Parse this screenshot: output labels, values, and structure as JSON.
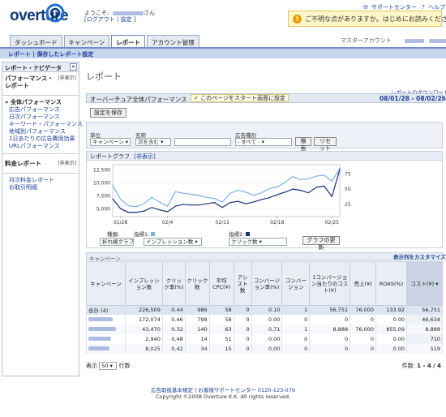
{
  "header": {
    "logo": "overture",
    "welcome_prefix": "ようこそ、",
    "welcome_suffix": "さん",
    "user_links": "[ログアウト | 設定 ]",
    "support_center": "サポートセンター",
    "help": "ヘルプ",
    "notice": "ご不明な点がありますか。はじめにお読みください。"
  },
  "tabs": [
    "ダッシュボード",
    "キャンペーン",
    "レポート",
    "アカウント管理"
  ],
  "active_tab": 2,
  "account_label": "マスターアカウント",
  "subnav": "レポート | 保存したレポート設定",
  "sidebar": {
    "title": "レポート・ナビゲータ",
    "collapse": "«",
    "perf_section": "パフォーマンス・レポート",
    "perf_visibility": "[非表示]",
    "perf_items": [
      "全体パフォーマンス",
      "広告パフォーマンス",
      "日次パフォーマンス",
      "キーワード・パフォーマンス",
      "地域別パフォーマンス",
      "1日あたりの広告費用効果",
      "URLパフォーマンス"
    ],
    "fee_section": "料金レポート",
    "fee_visibility": "[非表示]",
    "fee_items": [
      "月次料金レポート",
      "お取引明細"
    ]
  },
  "main": {
    "page_title": "レポート",
    "download_link": "レポートのダウンロード ▾",
    "report_title": "オーバーチュア全体パフォーマンス",
    "start_page_button": "このページをスタート画面に設定",
    "date_range": "08/01/28 - 08/02/26",
    "save_button": "設定を保存",
    "filters": {
      "unit_label": "単位",
      "unit_value": "キャンペーン",
      "name_label": "名称",
      "name_value": "次を含む",
      "adtype_label": "広告種別",
      "adtype_value": "- すべて -",
      "search_button": "検索",
      "reset_button": "リセット"
    },
    "graph": {
      "title": "レポートグラフ",
      "hide": "[非表示]",
      "type_label": "種類:",
      "type_value": "折れ線グラフ",
      "metric1_label": "指標1:",
      "metric1_value": "インプレッション数",
      "metric2_label": "指標2:",
      "metric2_value": "クリック数",
      "update_button": "グラフの更新"
    },
    "table": {
      "section_label": "キャンペーン",
      "customize_link": "表示列をカスタマイズ",
      "columns": [
        "キャンペーン",
        "インプレッション数",
        "クリック率(%)",
        "クリック数",
        "平均CPC(¥)",
        "アシスト数",
        "コンバージョン率(%)",
        "コンバージョン",
        "1コンバージョン当たりのコスト(¥)",
        "売上(¥)",
        "ROAS(%)",
        "コスト(¥) ▾"
      ],
      "total_row": [
        "合計 (4)",
        "226,509",
        "0.44",
        "986",
        "58",
        "0",
        "0.10",
        "1",
        "56,751",
        "76,000",
        "133.92",
        "56,751"
      ],
      "rows": [
        [
          "",
          "172,074",
          "0.46",
          "798",
          "58",
          "0",
          "0.00",
          "0",
          "0",
          "0",
          "0.00",
          "46,634"
        ],
        [
          "",
          "43,470",
          "0.32",
          "140",
          "63",
          "0",
          "0.71",
          "1",
          "8,888",
          "76,000",
          "855.09",
          "8,888"
        ],
        [
          "",
          "2,940",
          "0.48",
          "14",
          "51",
          "0",
          "0.00",
          "0",
          "0",
          "0",
          "0.00",
          "710"
        ],
        [
          "",
          "8,025",
          "0.42",
          "34",
          "15",
          "0",
          "0.00",
          "0",
          "0",
          "0",
          "0.00",
          "519"
        ]
      ],
      "per_page_label": "表示",
      "per_page_value": "50",
      "per_page_suffix": "行数",
      "count_label": "件数:",
      "count_value": "1 - 4 / 4"
    }
  },
  "footer": {
    "line1": "広告取扱基本規定 | お客様サポートセンター 0120-123-076",
    "line2": "Copyright ©2008 Overture K.K. All rights reserved."
  },
  "chart_data": {
    "type": "line",
    "x": [
      "01/28",
      "01/29",
      "01/30",
      "01/31",
      "02/01",
      "02/02",
      "02/03",
      "02/04",
      "02/05",
      "02/06",
      "02/07",
      "02/08",
      "02/09",
      "02/10",
      "02/11",
      "02/12",
      "02/13",
      "02/14",
      "02/15",
      "02/16",
      "02/17",
      "02/18",
      "02/19",
      "02/20",
      "02/21",
      "02/22",
      "02/23",
      "02/24",
      "02/25",
      "02/26"
    ],
    "x_tick_labels": [
      "01/28",
      "02/4",
      "02/11",
      "02/18",
      "02/25"
    ],
    "y_left_ticks": [
      "12,500",
      "10,000",
      "7,500",
      "5,000"
    ],
    "y_right_ticks": [
      "75",
      "50",
      "25"
    ],
    "y_left_range": [
      3500,
      13500
    ],
    "y_right_range": [
      5,
      90
    ],
    "colors": {
      "impressions": "#7fb0e8",
      "clicks": "#1a2f7a"
    },
    "series": [
      {
        "name": "インプレッション数",
        "axis": "left",
        "values": [
          9600,
          6800,
          5600,
          5400,
          6000,
          7200,
          6300,
          5500,
          8300,
          8000,
          7800,
          7600,
          7200,
          7000,
          6300,
          8000,
          8600,
          8200,
          7600,
          8100,
          8900,
          9200,
          10100,
          11200,
          10600,
          10800,
          11300,
          11500,
          10300,
          12800
        ]
      },
      {
        "name": "クリック数",
        "axis": "right",
        "values": [
          34,
          18,
          12,
          12,
          14,
          20,
          16,
          13,
          22,
          25,
          24,
          24,
          26,
          28,
          20,
          28,
          30,
          26,
          29,
          33,
          36,
          41,
          45,
          50,
          48,
          44,
          53,
          55,
          38,
          82
        ]
      }
    ]
  }
}
